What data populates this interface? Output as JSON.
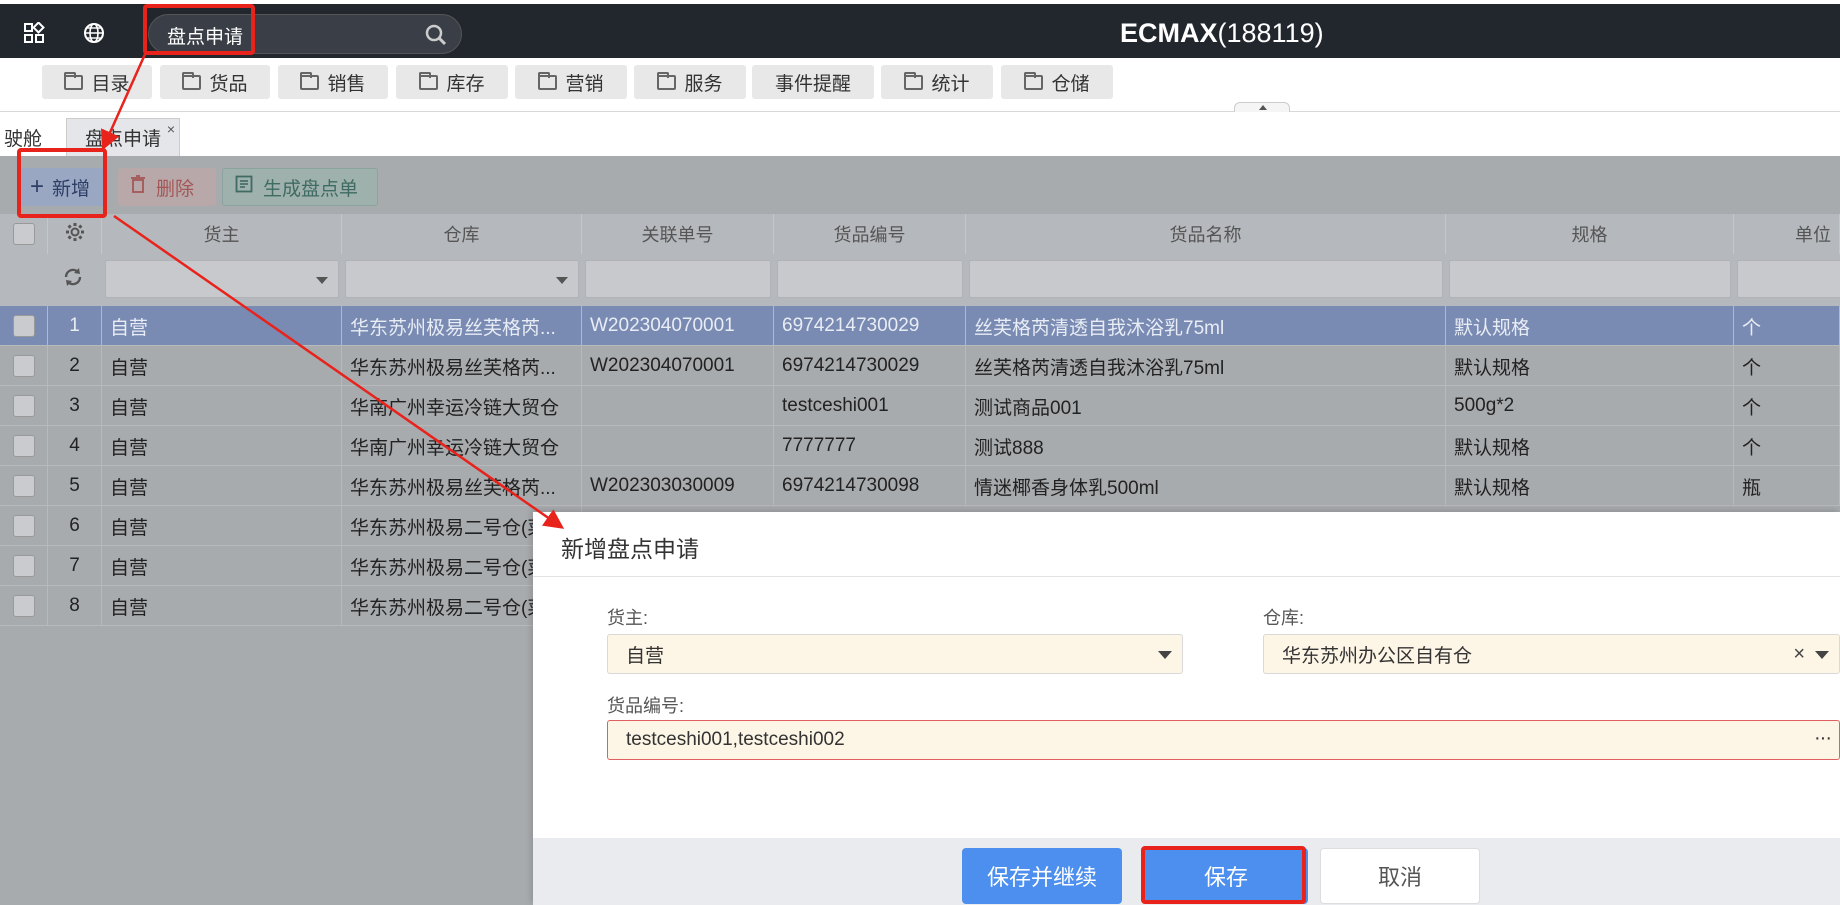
{
  "header": {
    "search_value": "盘点申请",
    "title_bold": "ECMAX",
    "title_suffix": "(188119)"
  },
  "menu": [
    {
      "label": "目录",
      "folder": true
    },
    {
      "label": "货品",
      "folder": true
    },
    {
      "label": "销售",
      "folder": true
    },
    {
      "label": "库存",
      "folder": true
    },
    {
      "label": "营销",
      "folder": true
    },
    {
      "label": "服务",
      "folder": true
    },
    {
      "label": "事件提醒",
      "folder": false
    },
    {
      "label": "统计",
      "folder": true
    },
    {
      "label": "仓储",
      "folder": true
    }
  ],
  "tabs": [
    {
      "label": "驶舱",
      "active": false
    },
    {
      "label": "盘点申请",
      "active": true,
      "close": "×"
    }
  ],
  "toolbar": {
    "add": "新增",
    "delete": "删除",
    "generate": "生成盘点单"
  },
  "columns": [
    "货主",
    "仓库",
    "关联单号",
    "货品编号",
    "货品名称",
    "规格",
    "单位"
  ],
  "rows": [
    {
      "no": "1",
      "owner": "自营",
      "warehouse": "华东苏州极易丝芙格芮...",
      "ref": "W202304070001",
      "code": "6974214730029",
      "name": "丝芙格芮清透自我沐浴乳75ml",
      "spec": "默认规格",
      "unit": "个"
    },
    {
      "no": "2",
      "owner": "自营",
      "warehouse": "华东苏州极易丝芙格芮...",
      "ref": "W202304070001",
      "code": "6974214730029",
      "name": "丝芙格芮清透自我沐浴乳75ml",
      "spec": "默认规格",
      "unit": "个"
    },
    {
      "no": "3",
      "owner": "自营",
      "warehouse": "华南广州幸运冷链大贸仓",
      "ref": "",
      "code": "testceshi001",
      "name": "测试商品001",
      "spec": "500g*2",
      "unit": "个"
    },
    {
      "no": "4",
      "owner": "自营",
      "warehouse": "华南广州幸运冷链大贸仓",
      "ref": "",
      "code": "7777777",
      "name": "测试888",
      "spec": "默认规格",
      "unit": "个"
    },
    {
      "no": "5",
      "owner": "自营",
      "warehouse": "华东苏州极易丝芙格芮...",
      "ref": "W202303030009",
      "code": "6974214730098",
      "name": "情迷椰香身体乳500ml",
      "spec": "默认规格",
      "unit": "瓶"
    },
    {
      "no": "6",
      "owner": "自营",
      "warehouse": "华东苏州极易二号仓(菜",
      "ref": "",
      "code": "",
      "name": "",
      "spec": "",
      "unit": ""
    },
    {
      "no": "7",
      "owner": "自营",
      "warehouse": "华东苏州极易二号仓(菜",
      "ref": "",
      "code": "",
      "name": "",
      "spec": "",
      "unit": ""
    },
    {
      "no": "8",
      "owner": "自营",
      "warehouse": "华东苏州极易二号仓(菜",
      "ref": "",
      "code": "",
      "name": "",
      "spec": "",
      "unit": ""
    }
  ],
  "modal": {
    "title": "新增盘点申请",
    "owner_label": "货主:",
    "owner_value": "自营",
    "warehouse_label": "仓库:",
    "warehouse_value": "华东苏州办公区自有仓",
    "clear_glyph": "×",
    "code_label": "货品编号:",
    "code_value": "testceshi001,testceshi002",
    "more_glyph": "···",
    "save_continue": "保存并继续",
    "save": "保存",
    "cancel": "取消"
  },
  "colors": {
    "annotation": "#e8231c",
    "primary": "#4d8fee",
    "topbar": "#22272e",
    "field_bg": "#fdf5e6"
  }
}
